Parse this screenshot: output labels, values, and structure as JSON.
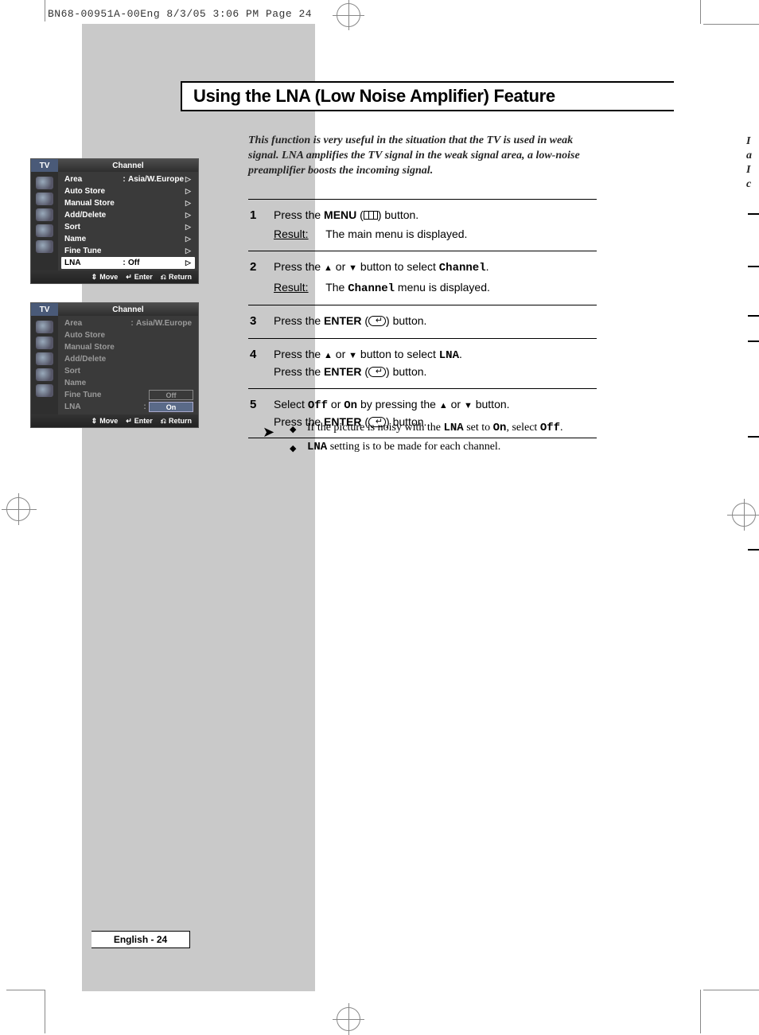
{
  "print_header": "BN68-00951A-00Eng  8/3/05  3:06 PM  Page 24",
  "title": "Using the LNA (Low Noise Amplifier) Feature",
  "intro": "This function is very useful in the situation that the TV is used in weak signal. LNA amplifies the TV signal in the weak signal area, a low-noise preamplifier boosts the incoming signal.",
  "steps": [
    {
      "num": "1",
      "line1_pre": "Press the ",
      "line1_bold": "MENU",
      "line1_post": " (",
      "line1_tail": ") button.",
      "result": "The main menu is displayed."
    },
    {
      "num": "2",
      "line1_pre": "Press the ",
      "line1_mid": " or ",
      "line1_post": " button to select ",
      "line1_mono": "Channel",
      "line1_tail": ".",
      "result": "The ",
      "result_mono": "Channel",
      "result_tail": " menu is displayed."
    },
    {
      "num": "3",
      "line1_pre": "Press the ",
      "line1_bold": "ENTER",
      "line1_post": " (",
      "line1_tail": ") button."
    },
    {
      "num": "4",
      "line1_pre": "Press the ",
      "line1_mid": " or ",
      "line1_post": " button to select ",
      "line1_mono": "LNA",
      "line1_tail": ".",
      "line2_pre": "Press the ",
      "line2_bold": "ENTER",
      "line2_post": " (",
      "line2_tail": ") button."
    },
    {
      "num": "5",
      "line1_pre": "Select ",
      "line1_mono1": "Off",
      "line1_mid1": " or ",
      "line1_mono2": "On",
      "line1_mid2": " by pressing the ",
      "line1_mid3": " or ",
      "line1_tail": " button.",
      "line2_pre": "Press the ",
      "line2_bold": "ENTER",
      "line2_post": " (",
      "line2_tail": ") button."
    }
  ],
  "notes": [
    {
      "pre": "If the picture is noisy with the ",
      "m1": "LNA",
      "mid1": " set to ",
      "m2": "On",
      "mid2": ", select ",
      "m3": "Off",
      "tail": "."
    },
    {
      "pre": "",
      "m1": "LNA",
      "mid1": " setting is to be made for each channel.",
      "m2": "",
      "mid2": "",
      "m3": "",
      "tail": ""
    }
  ],
  "osd_common": {
    "tv": "TV",
    "title": "Channel",
    "footer": {
      "move": "Move",
      "enter": "Enter",
      "return": "Return"
    },
    "result_label": "Result:"
  },
  "osd1": {
    "rows": [
      {
        "label": "Area",
        "colon": ":",
        "value": "Asia/W.Europe",
        "arrow": true,
        "sel": false
      },
      {
        "label": "Auto Store",
        "value": "",
        "arrow": true
      },
      {
        "label": "Manual Store",
        "value": "",
        "arrow": true
      },
      {
        "label": "Add/Delete",
        "value": "",
        "arrow": true
      },
      {
        "label": "Sort",
        "value": "",
        "arrow": true
      },
      {
        "label": "Name",
        "value": "",
        "arrow": true
      },
      {
        "label": "Fine Tune",
        "value": "",
        "arrow": true
      },
      {
        "label": "LNA",
        "colon": ":",
        "value": "Off",
        "arrow": true,
        "sel": true
      }
    ]
  },
  "osd2": {
    "rows": [
      {
        "label": "Area",
        "colon": ":",
        "value": "Asia/W.Europe"
      },
      {
        "label": "Auto Store"
      },
      {
        "label": "Manual Store"
      },
      {
        "label": "Add/Delete"
      },
      {
        "label": "Sort"
      },
      {
        "label": "Name"
      },
      {
        "label": "Fine Tune",
        "sub_off": "Off"
      },
      {
        "label": "LNA",
        "colon": ":",
        "sub_on": "On"
      }
    ]
  },
  "page_footer": "English - 24",
  "edge": {
    "l1": "I",
    "l2": "a",
    "l3": "I",
    "l4": "c"
  }
}
